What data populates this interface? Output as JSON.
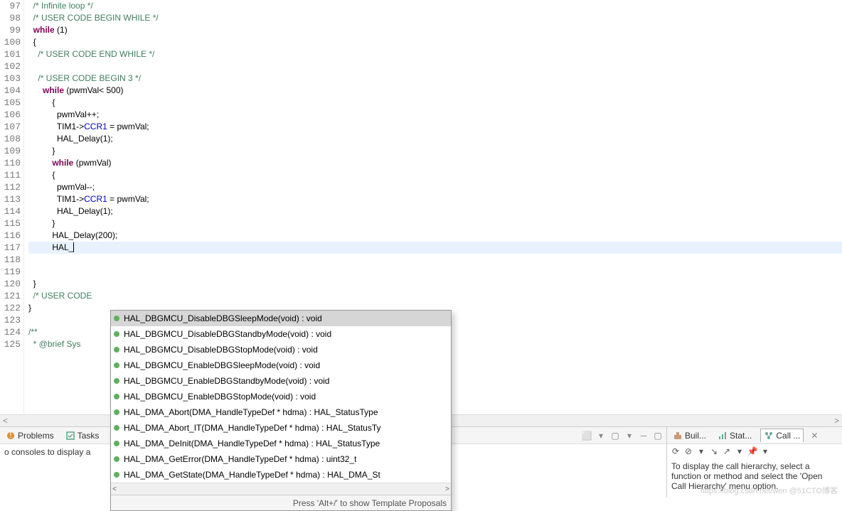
{
  "editor": {
    "lines": [
      {
        "n": 97,
        "seg": [
          {
            "t": "  ",
            "c": ""
          },
          {
            "t": "/* Infinite loop */",
            "c": "cm"
          }
        ]
      },
      {
        "n": 98,
        "seg": [
          {
            "t": "  ",
            "c": ""
          },
          {
            "t": "/* USER CODE BEGIN WHILE */",
            "c": "cm"
          }
        ]
      },
      {
        "n": 99,
        "seg": [
          {
            "t": "  ",
            "c": ""
          },
          {
            "t": "while",
            "c": "kw"
          },
          {
            "t": " (1)",
            "c": ""
          }
        ]
      },
      {
        "n": 100,
        "seg": [
          {
            "t": "  {",
            "c": ""
          }
        ]
      },
      {
        "n": 101,
        "seg": [
          {
            "t": "    ",
            "c": ""
          },
          {
            "t": "/* USER CODE END WHILE */",
            "c": "cm"
          }
        ]
      },
      {
        "n": 102,
        "seg": [
          {
            "t": "",
            "c": ""
          }
        ]
      },
      {
        "n": 103,
        "seg": [
          {
            "t": "    ",
            "c": ""
          },
          {
            "t": "/* USER CODE BEGIN 3 */",
            "c": "cm"
          }
        ]
      },
      {
        "n": 104,
        "seg": [
          {
            "t": "      ",
            "c": ""
          },
          {
            "t": "while",
            "c": "kw"
          },
          {
            "t": " (pwmVal< 500)",
            "c": ""
          }
        ]
      },
      {
        "n": 105,
        "seg": [
          {
            "t": "          {",
            "c": ""
          }
        ]
      },
      {
        "n": 106,
        "seg": [
          {
            "t": "            pwmVal++;",
            "c": ""
          }
        ]
      },
      {
        "n": 107,
        "seg": [
          {
            "t": "            TIM1->",
            "c": ""
          },
          {
            "t": "CCR1",
            "c": "sym"
          },
          {
            "t": " = pwmVal;",
            "c": ""
          }
        ]
      },
      {
        "n": 108,
        "seg": [
          {
            "t": "            HAL_Delay(1);",
            "c": ""
          }
        ]
      },
      {
        "n": 109,
        "seg": [
          {
            "t": "          }",
            "c": ""
          }
        ]
      },
      {
        "n": 110,
        "seg": [
          {
            "t": "          ",
            "c": ""
          },
          {
            "t": "while",
            "c": "kw"
          },
          {
            "t": " (pwmVal)",
            "c": ""
          }
        ]
      },
      {
        "n": 111,
        "seg": [
          {
            "t": "          {",
            "c": ""
          }
        ]
      },
      {
        "n": 112,
        "seg": [
          {
            "t": "            pwmVal--;",
            "c": ""
          }
        ]
      },
      {
        "n": 113,
        "seg": [
          {
            "t": "            TIM1->",
            "c": ""
          },
          {
            "t": "CCR1",
            "c": "sym"
          },
          {
            "t": " = pwmVal;",
            "c": ""
          }
        ]
      },
      {
        "n": 114,
        "seg": [
          {
            "t": "            HAL_Delay(1);",
            "c": ""
          }
        ]
      },
      {
        "n": 115,
        "seg": [
          {
            "t": "          }",
            "c": ""
          }
        ]
      },
      {
        "n": 116,
        "seg": [
          {
            "t": "          HAL_Delay(200);",
            "c": ""
          }
        ]
      },
      {
        "n": 117,
        "seg": [
          {
            "t": "          HAL_",
            "c": ""
          }
        ],
        "hl": true,
        "cursor": true
      },
      {
        "n": 118,
        "seg": [
          {
            "t": "",
            "c": ""
          }
        ]
      },
      {
        "n": 119,
        "seg": [
          {
            "t": "",
            "c": ""
          }
        ]
      },
      {
        "n": 120,
        "seg": [
          {
            "t": "  }",
            "c": ""
          }
        ]
      },
      {
        "n": 121,
        "seg": [
          {
            "t": "  ",
            "c": ""
          },
          {
            "t": "/* USER CODE",
            "c": "cm"
          }
        ]
      },
      {
        "n": 122,
        "seg": [
          {
            "t": "}",
            "c": ""
          }
        ]
      },
      {
        "n": 123,
        "seg": [
          {
            "t": "",
            "c": ""
          }
        ]
      },
      {
        "n": 124,
        "seg": [
          {
            "t": "/**",
            "c": "cm"
          }
        ],
        "folded": true
      },
      {
        "n": 125,
        "seg": [
          {
            "t": "  * ",
            "c": "cm"
          },
          {
            "t": "@brief",
            "c": "cm"
          },
          {
            "t": " Sys",
            "c": "cm"
          }
        ]
      }
    ]
  },
  "autocomplete": {
    "items": [
      {
        "label": "HAL_DBGMCU_DisableDBGSleepMode(void) : void",
        "sel": true
      },
      {
        "label": "HAL_DBGMCU_DisableDBGStandbyMode(void) : void"
      },
      {
        "label": "HAL_DBGMCU_DisableDBGStopMode(void) : void"
      },
      {
        "label": "HAL_DBGMCU_EnableDBGSleepMode(void) : void"
      },
      {
        "label": "HAL_DBGMCU_EnableDBGStandbyMode(void) : void"
      },
      {
        "label": "HAL_DBGMCU_EnableDBGStopMode(void) : void"
      },
      {
        "label": "HAL_DMA_Abort(DMA_HandleTypeDef * hdma) : HAL_StatusType"
      },
      {
        "label": "HAL_DMA_Abort_IT(DMA_HandleTypeDef * hdma) : HAL_StatusTy"
      },
      {
        "label": "HAL_DMA_DeInit(DMA_HandleTypeDef * hdma) : HAL_StatusType"
      },
      {
        "label": "HAL_DMA_GetError(DMA_HandleTypeDef * hdma) : uint32_t"
      },
      {
        "label": "HAL_DMA_GetState(DMA_HandleTypeDef * hdma) : HAL_DMA_St"
      }
    ],
    "footer": "Press 'Alt+/' to show Template Proposals"
  },
  "panels": {
    "left": {
      "tabs": [
        {
          "label": "Problems"
        },
        {
          "label": "Tasks"
        }
      ],
      "body": "o consoles to display a"
    },
    "right": {
      "tabs": [
        {
          "label": "Buil..."
        },
        {
          "label": "Stat..."
        },
        {
          "label": "Call ...",
          "active": true
        }
      ],
      "body": "To display the call hierarchy, select a function or method and select the 'Open Call Hierarchy' menu option."
    }
  },
  "watermark": "https://blog.csdn.net/wen @51CTO博客"
}
